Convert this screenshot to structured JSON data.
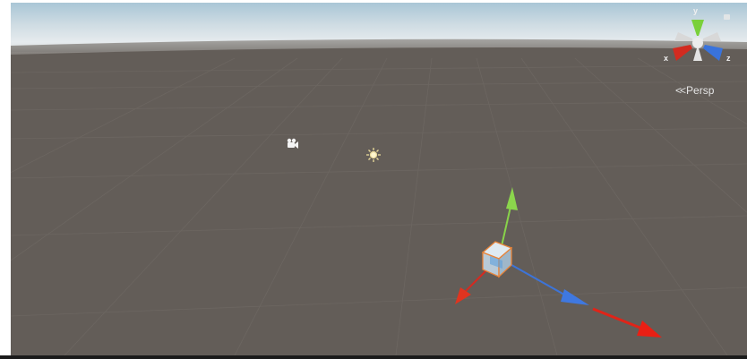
{
  "scene_view": {
    "projection_label": "Persp",
    "axis_labels": {
      "x": "x",
      "y": "y",
      "z": "z"
    }
  },
  "icons": {
    "camera": "camera-gizmo-icon",
    "light": "directional-light-icon",
    "cube": "selected-cube-object",
    "move_tool": "move-handle-gizmo",
    "orientation": "scene-orientation-gizmo"
  },
  "colors": {
    "ground": "#635d58",
    "sky_top": "#a8c6d8",
    "x_axis": "#d42a20",
    "y_axis": "#88d24a",
    "z_axis": "#3d74d8",
    "selection_outline": "#e8843a"
  }
}
